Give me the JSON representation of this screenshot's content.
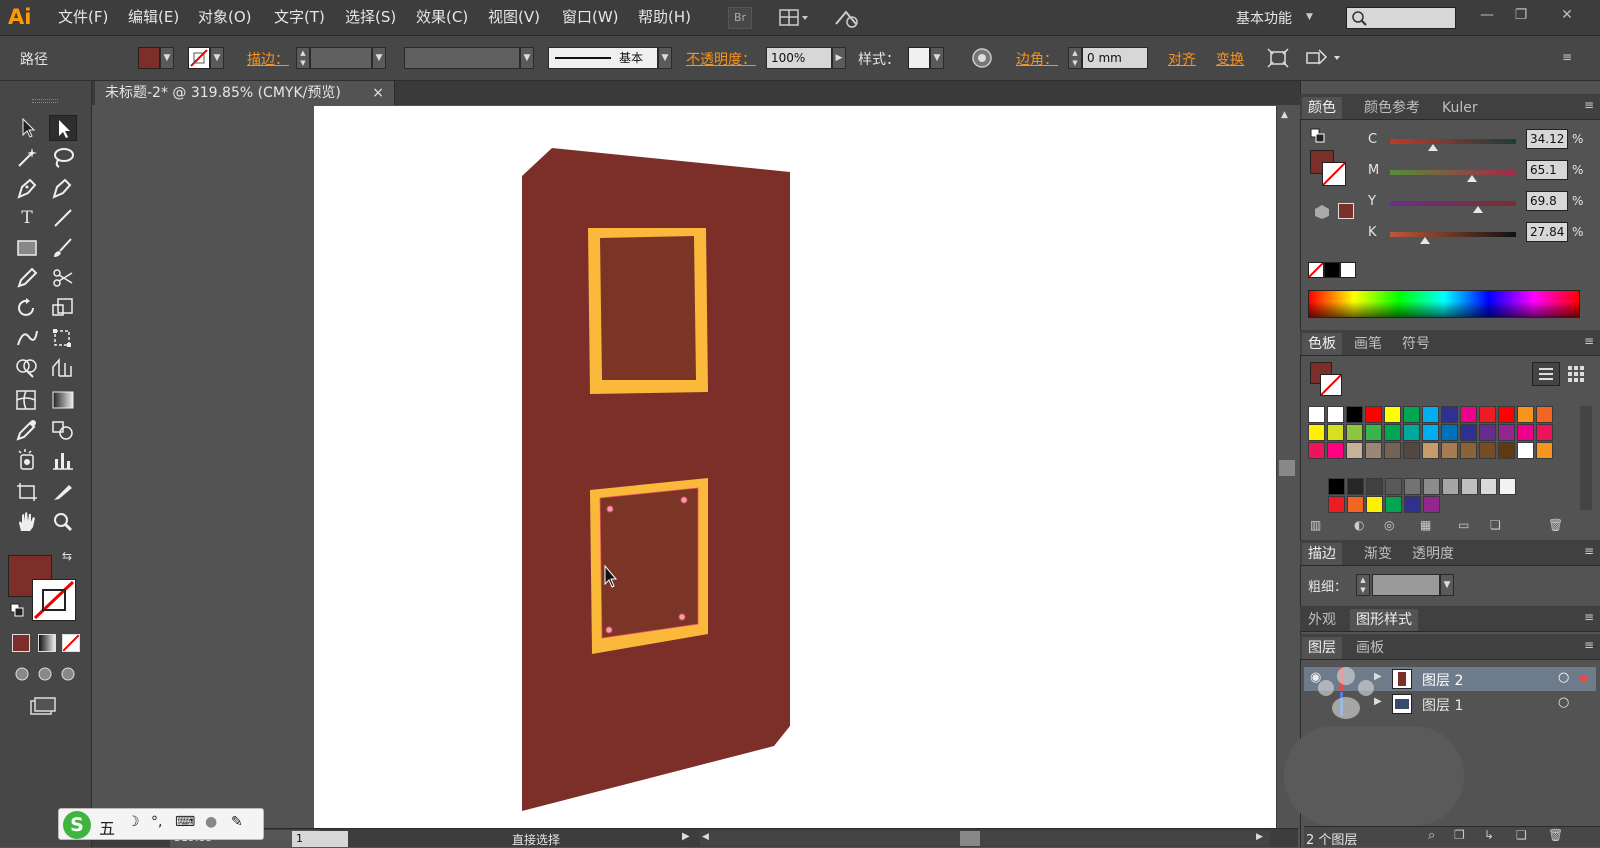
{
  "app": {
    "logo": "Ai"
  },
  "menu": [
    "文件(F)",
    "编辑(E)",
    "对象(O)",
    "文字(T)",
    "选择(S)",
    "效果(C)",
    "视图(V)",
    "窗口(W)",
    "帮助(H)"
  ],
  "menubar_buttons": {
    "br": "Br"
  },
  "workspace": "基本功能",
  "window_controls": {
    "minimize": "—",
    "restore": "❐",
    "close": "✕"
  },
  "control_bar": {
    "object_label": "路径",
    "stroke_label": "描边：",
    "stroke_profile": "基本",
    "opacity_label": "不透明度：",
    "opacity_value": "100%",
    "style_label": "样式：",
    "corner_label": "边角：",
    "corner_value": "0 mm",
    "align_label": "对齐",
    "transform_label": "变换"
  },
  "document_tab": {
    "title": "未标题-2* @ 319.85% (CMYK/预览)",
    "close": "×"
  },
  "colors": {
    "fill": "#7b2f28",
    "window_fill": "#7a3526",
    "frame": "#fbb93c",
    "accent_orange": "#f7931e"
  },
  "color_panel": {
    "tabs": [
      "颜色",
      "颜色参考",
      "Kuler"
    ],
    "channels": [
      {
        "label": "C",
        "value": "34.12",
        "fraction": 0.34
      },
      {
        "label": "M",
        "value": "65.1",
        "fraction": 0.651
      },
      {
        "label": "Y",
        "value": "69.8",
        "fraction": 0.698
      },
      {
        "label": "K",
        "value": "27.84",
        "fraction": 0.2784
      }
    ],
    "percent": "%"
  },
  "swatches_panel": {
    "tabs": [
      "色板",
      "画笔",
      "符号"
    ],
    "rows": [
      [
        "#ffffff",
        "#ffffff",
        "#000000",
        "#ff0000",
        "#ffff00",
        "#00a651",
        "#00aeef",
        "#2e3192",
        "#ec008c",
        "#ed1c24",
        "#ff0000",
        "#f7941d",
        "#f26522"
      ],
      [
        "#fff200",
        "#d7df23",
        "#8dc63f",
        "#39b54a",
        "#00a651",
        "#00a99d",
        "#00aeef",
        "#0072bc",
        "#2e3192",
        "#662d91",
        "#92278f",
        "#ec008c",
        "#ed145b"
      ],
      [
        "#ed145b",
        "#ff0080",
        "#c7b299",
        "#998675",
        "#736357",
        "#534741",
        "#c69c6d",
        "#a67c52",
        "#8c6239",
        "#754c24",
        "#603913",
        "#ffffff",
        "#f7941d"
      ],
      [
        "#000000",
        "#262626",
        "#404040",
        "#595959",
        "#737373",
        "#8c8c8c",
        "#a6a6a6",
        "#bfbfbf",
        "#d9d9d9",
        "#f2f2f2"
      ],
      [
        "#ed1c24",
        "#f26522",
        "#fff200",
        "#00a651",
        "#2e3192",
        "#92278f"
      ]
    ]
  },
  "stroke_panel": {
    "tabs": [
      "描边",
      "渐变",
      "透明度"
    ],
    "weight_label": "粗细："
  },
  "appearance_panel": {
    "tabs": [
      "外观",
      "图形样式"
    ]
  },
  "layers_panel": {
    "tabs": [
      "图层",
      "画板"
    ],
    "layers": [
      "图层 2",
      "图层 1"
    ],
    "count": "2 个图层"
  },
  "status_bar": {
    "zoom": "319.85",
    "page": "1",
    "tool": "直接选择"
  },
  "ime": {
    "mode": "五"
  }
}
